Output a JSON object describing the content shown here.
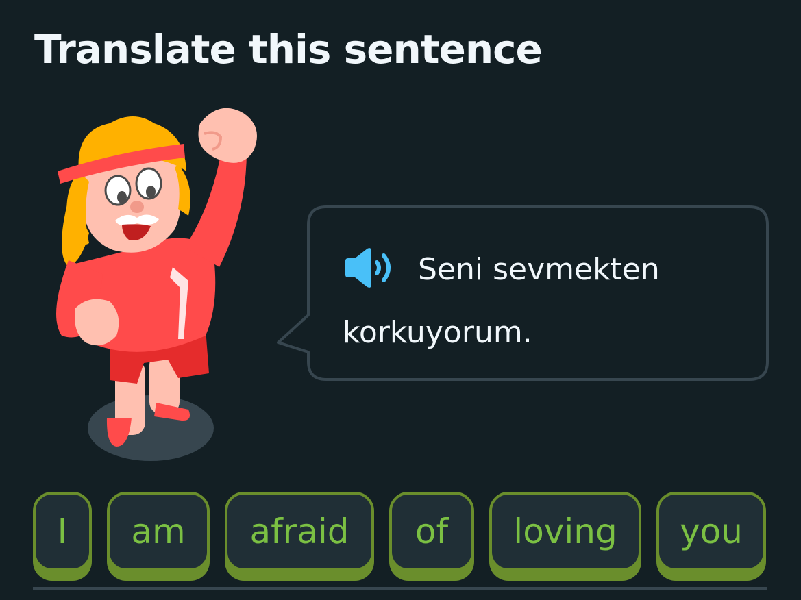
{
  "header": {
    "title": "Translate this sentence"
  },
  "prompt": {
    "speaker_icon": "speaker-icon",
    "sentence": "Seni sevmekten korkuyorum."
  },
  "word_bank": {
    "tiles": [
      {
        "label": "I"
      },
      {
        "label": "am"
      },
      {
        "label": "afraid"
      },
      {
        "label": "of"
      },
      {
        "label": "loving"
      },
      {
        "label": "you"
      }
    ]
  },
  "colors": {
    "background": "#131f24",
    "bubble_border": "#37464f",
    "tile_border": "#6a8e2c",
    "tile_text": "#7bc043",
    "speaker": "#49c0f8"
  }
}
